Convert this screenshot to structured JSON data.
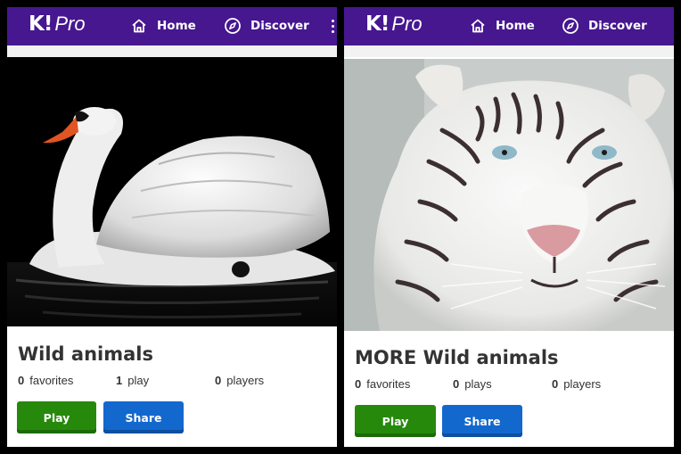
{
  "colors": {
    "topbar": "#46178f",
    "play_button": "#26890c",
    "share_button": "#1368ce",
    "background": "#000000"
  },
  "cards": [
    {
      "app": {
        "logo_mark": "K!",
        "logo_suffix": "Pro"
      },
      "nav": {
        "home": "Home",
        "discover": "Discover"
      },
      "image": "swan-photo",
      "title": "Wild animals",
      "stats": {
        "favorites_count": "0",
        "favorites_label": "favorites",
        "plays_count": "1",
        "plays_label": "play",
        "players_count": "0",
        "players_label": "players"
      },
      "buttons": {
        "play": "Play",
        "share": "Share"
      }
    },
    {
      "app": {
        "logo_mark": "K!",
        "logo_suffix": "Pro"
      },
      "nav": {
        "home": "Home",
        "discover": "Discover"
      },
      "image": "white-tiger-photo",
      "title": "MORE Wild animals",
      "stats": {
        "favorites_count": "0",
        "favorites_label": "favorites",
        "plays_count": "0",
        "plays_label": "plays",
        "players_count": "0",
        "players_label": "players"
      },
      "buttons": {
        "play": "Play",
        "share": "Share"
      }
    }
  ]
}
